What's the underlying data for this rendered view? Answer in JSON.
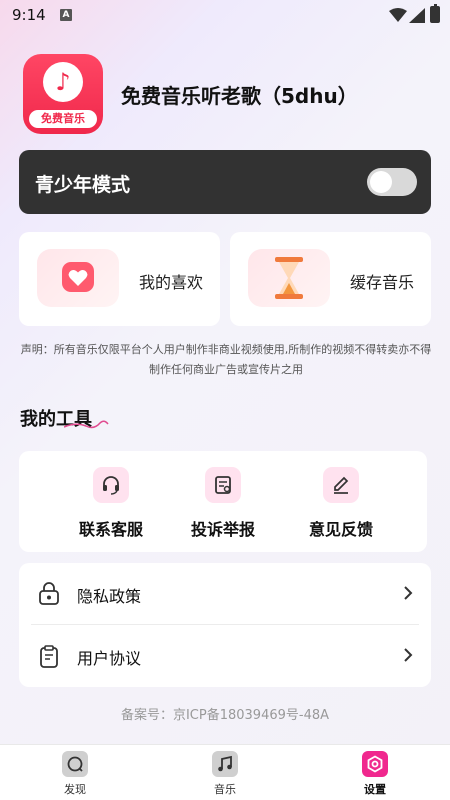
{
  "status_bar": {
    "time": "9:14",
    "notif_letter": "A"
  },
  "header": {
    "app_name": "免费音乐听老歌（5dhu）",
    "logo_text": "免费音乐"
  },
  "youth_mode": {
    "label": "青少年模式",
    "enabled": false
  },
  "shortcuts": [
    {
      "label": "我的喜欢",
      "icon": "heart-icon"
    },
    {
      "label": "缓存音乐",
      "icon": "hourglass-icon"
    }
  ],
  "disclaimer": "声明：所有音乐仅限平台个人用户制作非商业视频使用,所制作的视频不得转卖亦不得制作任何商业广告或宣传片之用",
  "tools": {
    "title": "我的工具",
    "items": [
      {
        "label": "联系客服",
        "icon": "headset-icon"
      },
      {
        "label": "投诉举报",
        "icon": "report-icon"
      },
      {
        "label": "意见反馈",
        "icon": "edit-icon"
      }
    ]
  },
  "policies": [
    {
      "label": "隐私政策",
      "icon": "lock-icon"
    },
    {
      "label": "用户协议",
      "icon": "clipboard-icon"
    }
  ],
  "icp": "备案号：京ICP备18039469号-48A",
  "bottom_nav": {
    "items": [
      {
        "label": "发现",
        "icon": "discover-icon"
      },
      {
        "label": "音乐",
        "icon": "music-note-icon"
      },
      {
        "label": "设置",
        "icon": "settings-icon",
        "active": true
      }
    ]
  },
  "colors": {
    "accent": "#f0288e",
    "logo_red": "#f0284b",
    "youth_card": "#323232"
  }
}
